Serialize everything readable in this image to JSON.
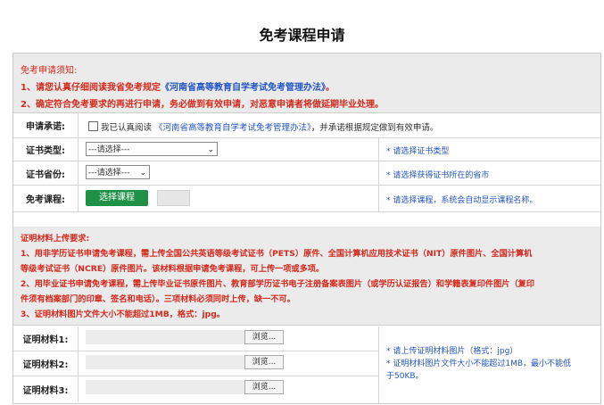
{
  "page_title": "免考课程申请",
  "notice": {
    "heading": "免考申请须知:",
    "line1_prefix": "1、请您认真仔细阅读我省免考规定",
    "line1_doc": "《河南省高等教育自学考试免考管理办法》",
    "line1_suffix": "。",
    "line2": "2、确定符合免考要求的再进行申请，务必做到有效申请，对恶意申请者将做延期毕业处理。"
  },
  "promise": {
    "label": "申请承诺:",
    "prefix": "我已认真阅读",
    "doc": "《河南省高等教育自学考试免考管理办法》",
    "suffix": "，并承诺根据规定做到有效申请。"
  },
  "cert_type": {
    "label": "证书类型:",
    "selected": "---请选择---",
    "hint": "* 请选择证书类型"
  },
  "cert_province": {
    "label": "证书省份:",
    "selected": "---请选择---",
    "hint": "* 请选择获得证书所在的省市"
  },
  "course": {
    "label": "免考课程:",
    "button": "选择课程",
    "hint": "* 请选择课程，系统会自动显示课程名称。"
  },
  "upload_requirements": {
    "heading": "证明材料上传要求:",
    "line1a": "1、用非学历证书申请免考课程，需上传全国公共英语等级考试证书（PETS）原件、全国计算机应用技术证书（NIT）原件图片、全国计算机",
    "line1b": "等级考试证书（NCRE）原件图片。该材料根据申请免考课程，可上传一项或多项。",
    "line2a": "2、用毕业证书申请免考课程，需上传毕业证书原件图片、教育部学历证书电子注册备案表图片（或学历认证报告）和学籍表复印件图片（复印",
    "line2b": "件须有档案部门的印章、签名和电话）。三项材料必须同时上传，缺一不可。",
    "line3": "3、证明材料图片文件大小不能超过1MB，格式：jpg。"
  },
  "materials": [
    {
      "label": "证明材料1:",
      "browse": "浏览..."
    },
    {
      "label": "证明材料2:",
      "browse": "浏览..."
    },
    {
      "label": "证明材料3:",
      "browse": "浏览..."
    }
  ],
  "materials_hint": {
    "line1": "* 请上传证明材料图片（格式：jpg）",
    "line2": "* 证明材料图片文件大小不能超过1MB，最小不能低",
    "line3": "于50KB。"
  },
  "colors": {
    "warning_red": "#d42a1e",
    "link_blue": "#2255c4",
    "button_green": "#1f9147",
    "section_gray": "#ebebeb"
  }
}
